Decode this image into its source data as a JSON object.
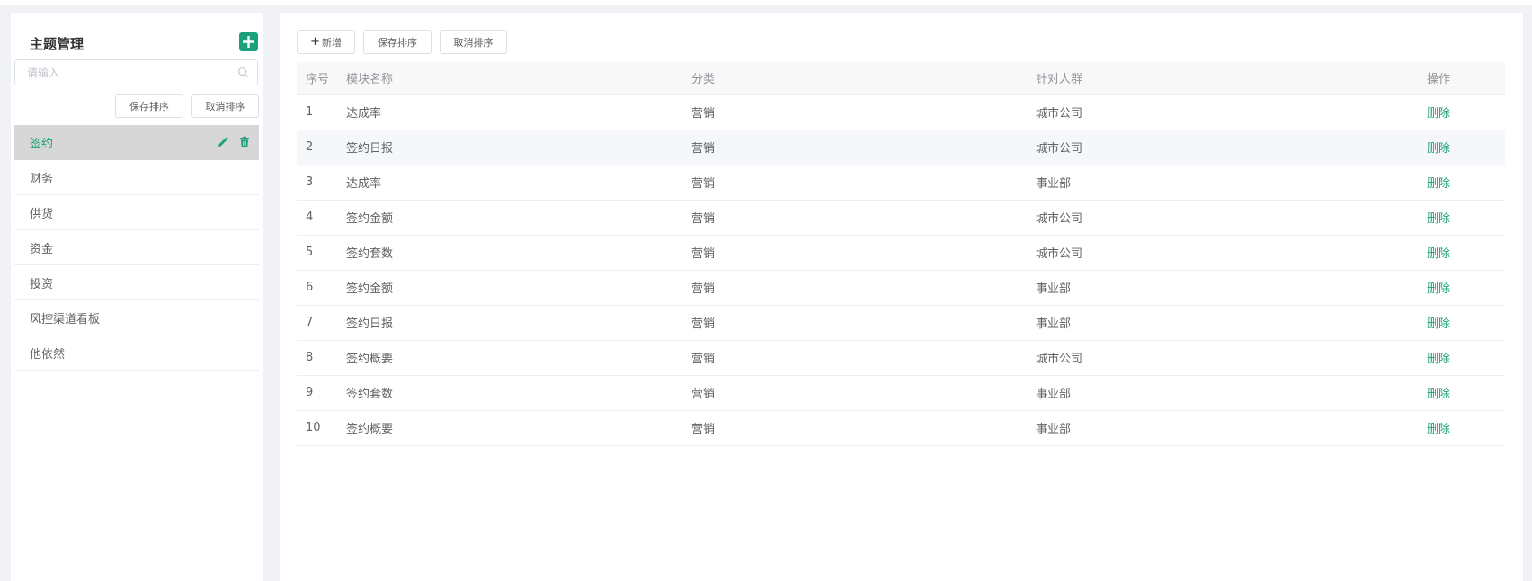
{
  "sidebar": {
    "title": "主题管理",
    "search_placeholder": "请输入",
    "save_sort_label": "保存排序",
    "cancel_sort_label": "取消排序",
    "items": [
      {
        "label": "签约",
        "active": true
      },
      {
        "label": "财务"
      },
      {
        "label": "供货"
      },
      {
        "label": "资金"
      },
      {
        "label": "投资"
      },
      {
        "label": "风控渠道看板"
      },
      {
        "label": "他依然"
      }
    ]
  },
  "toolbar": {
    "add_label": "新增",
    "save_sort_label": "保存排序",
    "cancel_sort_label": "取消排序"
  },
  "table": {
    "headers": {
      "index": "序号",
      "name": "模块名称",
      "category": "分类",
      "audience": "针对人群",
      "action": "操作"
    },
    "rows": [
      {
        "index": "1",
        "name": "达成率",
        "category": "营销",
        "audience": "城市公司",
        "action": "删除"
      },
      {
        "index": "2",
        "name": "签约日报",
        "category": "营销",
        "audience": "城市公司",
        "action": "删除"
      },
      {
        "index": "3",
        "name": "达成率",
        "category": "营销",
        "audience": "事业部",
        "action": "删除"
      },
      {
        "index": "4",
        "name": "签约金额",
        "category": "营销",
        "audience": "城市公司",
        "action": "删除"
      },
      {
        "index": "5",
        "name": "签约套数",
        "category": "营销",
        "audience": "城市公司",
        "action": "删除"
      },
      {
        "index": "6",
        "name": "签约金额",
        "category": "营销",
        "audience": "事业部",
        "action": "删除"
      },
      {
        "index": "7",
        "name": "签约日报",
        "category": "营销",
        "audience": "事业部",
        "action": "删除"
      },
      {
        "index": "8",
        "name": "签约概要",
        "category": "营销",
        "audience": "城市公司",
        "action": "删除"
      },
      {
        "index": "9",
        "name": "签约套数",
        "category": "营销",
        "audience": "事业部",
        "action": "删除"
      },
      {
        "index": "10",
        "name": "签约概要",
        "category": "营销",
        "audience": "事业部",
        "action": "删除"
      }
    ]
  },
  "colors": {
    "accent": "#1aa07a",
    "active_bg": "#d7d7d7"
  }
}
